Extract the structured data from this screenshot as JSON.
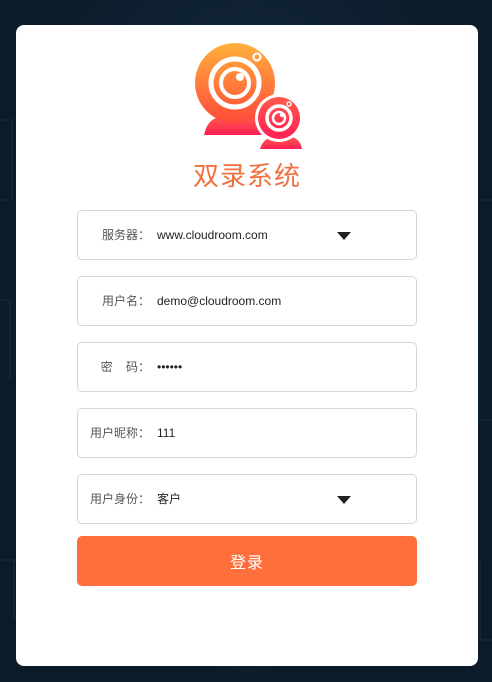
{
  "app_title": "双录系统",
  "form": {
    "server": {
      "label": "服务器：",
      "value": "www.cloudroom.com"
    },
    "username": {
      "label": "用户名：",
      "value": "demo@cloudroom.com"
    },
    "password": {
      "label": "密    码：",
      "value": "••••••"
    },
    "nickname": {
      "label": "用户昵称：",
      "value": "111"
    },
    "identity": {
      "label": "用户身份：",
      "value": "客户"
    },
    "submit_label": "登录"
  },
  "colors": {
    "accent": "#ff6f3c",
    "title": "#f07040",
    "logo_top": "#ffb13c",
    "logo_bottom": "#ff2d55",
    "background": "#0c1b29"
  },
  "icons": [
    "webcam-logo-icon",
    "dropdown-caret-icon"
  ]
}
